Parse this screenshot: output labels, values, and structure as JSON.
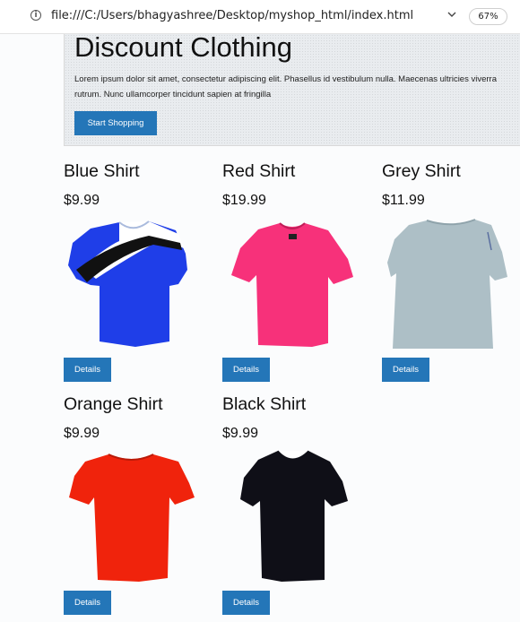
{
  "browser": {
    "url": "file:///C:/Users/bhagyashree/Desktop/myshop_html/index.html",
    "zoom": "67%"
  },
  "hero": {
    "title": "Discount Clothing",
    "text": "Lorem ipsum dolor sit amet, consectetur adipiscing elit. Phasellus id vestibulum nulla. Maecenas ultricies viverra rutrum. Nunc ullamcorper tincidunt sapien at fringilla",
    "button": "Start Shopping"
  },
  "products": [
    {
      "name": "Blue Shirt",
      "price": "$9.99",
      "color": "#1f3ee8",
      "button": "Details"
    },
    {
      "name": "Red Shirt",
      "price": "$19.99",
      "color": "#f7317a",
      "button": "Details"
    },
    {
      "name": "Grey Shirt",
      "price": "$11.99",
      "color": "#adbfc6",
      "button": "Details"
    },
    {
      "name": "Orange Shirt",
      "price": "$9.99",
      "color": "#f0230c",
      "button": "Details"
    },
    {
      "name": "Black Shirt",
      "price": "$9.99",
      "color": "#0f0f17",
      "button": "Details"
    }
  ],
  "colors": {
    "button": "#2476b8",
    "jumbotron": "#e9ecef"
  },
  "icons": {
    "site_info": "info-icon",
    "expand": "chevron-down-icon"
  }
}
